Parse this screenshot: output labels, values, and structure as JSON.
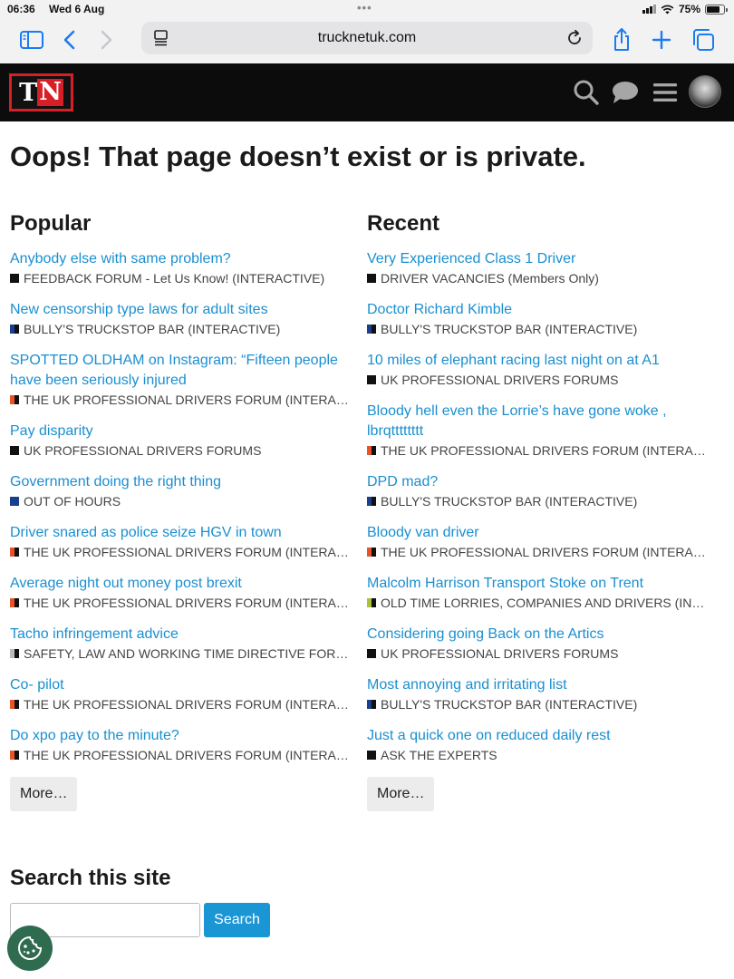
{
  "status_bar": {
    "time": "06:36",
    "date": "Wed 6 Aug",
    "battery": "75%",
    "battery_level": 0.75
  },
  "browser": {
    "url": "trucknetuk.com"
  },
  "site": {
    "logo_text": "TN"
  },
  "page": {
    "title": "Oops! That page doesn’t exist or is private.",
    "more_label": "More…",
    "search_heading": "Search this site",
    "search_button": "Search",
    "search_value": ""
  },
  "popular": {
    "heading": "Popular",
    "items": [
      {
        "title": "Anybody else with same problem?",
        "forum": "FEEDBACK FORUM - Let Us Know! (INTERACTIVE)",
        "colors": [
          "#111111",
          "#111111"
        ]
      },
      {
        "title": "New censorship type laws for adult sites",
        "forum": "BULLY'S TRUCKSTOP BAR (INTERACTIVE)",
        "colors": [
          "#1b3f8f",
          "#111111"
        ]
      },
      {
        "title": "SPOTTED OLDHAM on Instagram: “Fifteen people have been seriously injured",
        "forum": "THE UK PROFESSIONAL DRIVERS FORUM (INTERACTIVE)",
        "colors": [
          "#e8532a",
          "#111111"
        ]
      },
      {
        "title": "Pay disparity",
        "forum": "UK PROFESSIONAL DRIVERS FORUMS",
        "colors": [
          "#111111",
          "#111111"
        ]
      },
      {
        "title": "Government doing the right thing",
        "forum": "OUT OF HOURS",
        "colors": [
          "#1b3f8f",
          "#1b3f8f"
        ]
      },
      {
        "title": "Driver snared as police seize HGV in town",
        "forum": "THE UK PROFESSIONAL DRIVERS FORUM (INTERACTIVE)",
        "colors": [
          "#e8532a",
          "#111111"
        ]
      },
      {
        "title": "Average night out money post brexit",
        "forum": "THE UK PROFESSIONAL DRIVERS FORUM (INTERACTIVE)",
        "colors": [
          "#e8532a",
          "#111111"
        ]
      },
      {
        "title": "Tacho infringement advice",
        "forum": "SAFETY, LAW AND WORKING TIME DIRECTIVE FORUM",
        "colors": [
          "#bbbbbb",
          "#111111"
        ]
      },
      {
        "title": "Co- pilot",
        "forum": "THE UK PROFESSIONAL DRIVERS FORUM (INTERACTIVE)",
        "colors": [
          "#e8532a",
          "#111111"
        ]
      },
      {
        "title": "Do xpo pay to the minute?",
        "forum": "THE UK PROFESSIONAL DRIVERS FORUM (INTERACTIVE)",
        "colors": [
          "#e8532a",
          "#111111"
        ]
      }
    ]
  },
  "recent": {
    "heading": "Recent",
    "items": [
      {
        "title": "Very Experienced Class 1 Driver",
        "forum": "DRIVER VACANCIES (Members Only)",
        "colors": [
          "#111111",
          "#111111"
        ]
      },
      {
        "title": "Doctor Richard Kimble",
        "forum": "BULLY'S TRUCKSTOP BAR (INTERACTIVE)",
        "colors": [
          "#1b3f8f",
          "#111111"
        ]
      },
      {
        "title": "10 miles of elephant racing last night on at A1",
        "forum": "UK PROFESSIONAL DRIVERS FORUMS",
        "colors": [
          "#111111",
          "#111111"
        ]
      },
      {
        "title": "Bloody hell even the Lorrie’s have gone woke , lbrqtttttttt",
        "forum": "THE UK PROFESSIONAL DRIVERS FORUM (INTERACTIVE)",
        "colors": [
          "#e8532a",
          "#111111"
        ]
      },
      {
        "title": "DPD mad?",
        "forum": "BULLY'S TRUCKSTOP BAR (INTERACTIVE)",
        "colors": [
          "#1b3f8f",
          "#111111"
        ]
      },
      {
        "title": "Bloody van driver",
        "forum": "THE UK PROFESSIONAL DRIVERS FORUM (INTERACTIVE)",
        "colors": [
          "#e8532a",
          "#111111"
        ]
      },
      {
        "title": "Malcolm Harrison Transport Stoke on Trent",
        "forum": "OLD TIME LORRIES, COMPANIES AND DRIVERS (INTERACTIVE)",
        "colors": [
          "#a8c23a",
          "#111111"
        ]
      },
      {
        "title": "Considering going Back on the Artics",
        "forum": "UK PROFESSIONAL DRIVERS FORUMS",
        "colors": [
          "#111111",
          "#111111"
        ]
      },
      {
        "title": "Most annoying and irritating list",
        "forum": "BULLY'S TRUCKSTOP BAR (INTERACTIVE)",
        "colors": [
          "#1b3f8f",
          "#111111"
        ]
      },
      {
        "title": "Just a quick one on reduced daily rest",
        "forum": "ASK THE EXPERTS",
        "colors": [
          "#111111",
          "#111111"
        ]
      }
    ]
  }
}
